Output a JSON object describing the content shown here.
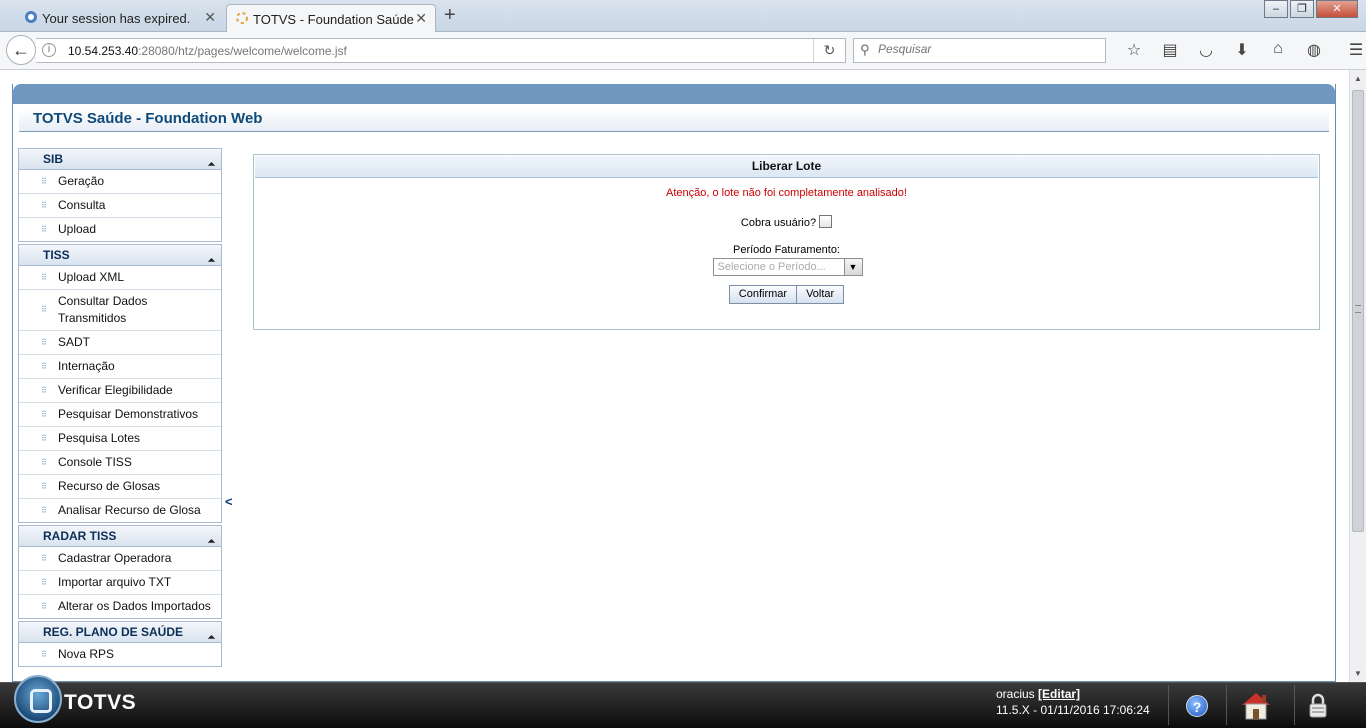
{
  "browser": {
    "tabs": [
      {
        "title": "Your session has expired.",
        "active": false
      },
      {
        "title": "TOTVS - Foundation Saúde",
        "active": true
      }
    ],
    "new_tab_label": "+",
    "url_host": "10.54.253.40",
    "url_rest": ":28080/htz/pages/welcome/welcome.jsf",
    "search_placeholder": "Pesquisar"
  },
  "app": {
    "title": "TOTVS Saúde - Foundation Web"
  },
  "sidebar": {
    "sections": [
      {
        "title": "SIB",
        "items": [
          "Geração",
          "Consulta",
          "Upload"
        ]
      },
      {
        "title": "TISS",
        "items": [
          "Upload XML",
          "Consultar Dados Transmitidos",
          "SADT",
          "Internação",
          "Verificar Elegibilidade",
          "Pesquisar Demonstrativos",
          "Pesquisa Lotes",
          "Console TISS",
          "Recurso de Glosas",
          "Analisar Recurso de Glosa"
        ]
      },
      {
        "title": "RADAR TISS",
        "items": [
          "Cadastrar Operadora",
          "Importar arquivo TXT",
          "Alterar os Dados Importados"
        ]
      },
      {
        "title": "REG. PLANO DE SAÚDE",
        "items": [
          "Nova RPS"
        ]
      }
    ],
    "collapse_label": "<"
  },
  "panel": {
    "title": "Liberar Lote",
    "warning": "Atenção, o lote não foi completamente analisado!",
    "cobra_label": "Cobra usuário?",
    "cobra_checked": false,
    "periodo_label": "Período Faturamento:",
    "periodo_placeholder": "Selecione o Período...",
    "confirm_label": "Confirmar",
    "back_label": "Voltar"
  },
  "taskbar": {
    "brand": "TOTVS",
    "user": "oracius",
    "edit_label": "[Editar]",
    "version": "11.5.X - 01/11/2016 17:06:24",
    "help_label": "?"
  },
  "colors": {
    "header_text": "#0f4b7a",
    "warning": "#cc0000",
    "band": "#6f97bf"
  }
}
